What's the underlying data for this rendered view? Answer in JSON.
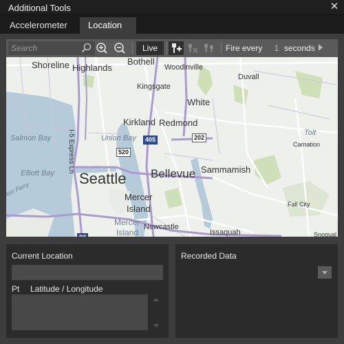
{
  "window": {
    "title": "Additional Tools",
    "close_glyph": "✕"
  },
  "tabs": [
    {
      "label": "Accelerometer",
      "selected": false
    },
    {
      "label": "Location",
      "selected": true
    }
  ],
  "toolbar": {
    "search_placeholder": "Search",
    "live_label": "Live",
    "fire_every_label": "Fire every",
    "interval_value": "1",
    "seconds_label": "seconds",
    "icons": [
      "search-icon",
      "zoom-in-icon",
      "zoom-out-icon",
      "add-pushpin-icon",
      "clear-pushpins-icon",
      "route-icon",
      "play-icon"
    ]
  },
  "map": {
    "cities": [
      "Shoreline",
      "Highlands",
      "Bothell",
      "Woodinville",
      "Kingsgate",
      "Duvall",
      "White",
      "Kirkland",
      "Redmond",
      "Seattle",
      "Bellevue",
      "Sammamish",
      "Mercer",
      "Island",
      "Mercer",
      "Island",
      "Newcastle",
      "Issaquah",
      "Carnation",
      "Fall City",
      "Snoqual",
      "ton Ferry"
    ],
    "water_labels": [
      "Salmon Bay",
      "Union Bay",
      "Elliott Bay",
      "Tolt"
    ],
    "road_labels": [
      "I-5 Express Ln"
    ],
    "shields": [
      "520",
      "405",
      "202",
      "90"
    ],
    "colors": {
      "land": "#eef0ec",
      "water": "#b5cbd9",
      "highway": "#a99ad0",
      "major_road": "#ffffff",
      "park": "#cfe0b8"
    }
  },
  "current_location": {
    "header": "Current Location",
    "value": "",
    "columns": [
      "Pt",
      "Latitude / Longitude"
    ],
    "rows": []
  },
  "recorded_data": {
    "header": "Recorded Data",
    "selected": ""
  }
}
